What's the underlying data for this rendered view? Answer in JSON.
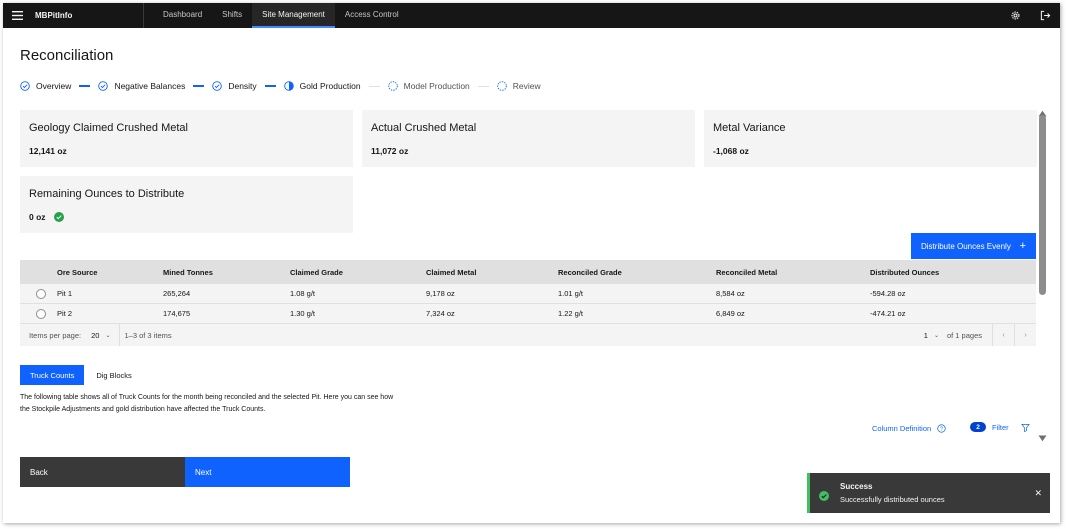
{
  "app": {
    "brand": "MBPitInfo"
  },
  "nav": {
    "items": [
      {
        "label": "Dashboard"
      },
      {
        "label": "Shifts"
      },
      {
        "label": "Site Management"
      },
      {
        "label": "Access Control"
      }
    ],
    "active": "Site Management"
  },
  "page": {
    "title": "Reconciliation"
  },
  "progress": {
    "steps": [
      {
        "label": "Overview",
        "state": "complete"
      },
      {
        "label": "Negative Balances",
        "state": "complete"
      },
      {
        "label": "Density",
        "state": "complete"
      },
      {
        "label": "Gold Production",
        "state": "current"
      },
      {
        "label": "Model Production",
        "state": "incomplete"
      },
      {
        "label": "Review",
        "state": "incomplete"
      }
    ]
  },
  "tiles": {
    "geology": {
      "title": "Geology Claimed Crushed Metal",
      "value": "12,141 oz"
    },
    "actual": {
      "title": "Actual Crushed Metal",
      "value": "11,072 oz"
    },
    "variance": {
      "title": "Metal Variance",
      "value": "-1,068 oz"
    },
    "remaining": {
      "title": "Remaining Ounces to Distribute",
      "value": "0 oz",
      "status_icon": "checkmark-filled-icon"
    }
  },
  "distribute_button": {
    "label": "Distribute Ounces Evenly",
    "icon": "add-icon"
  },
  "table": {
    "headers": [
      "Ore Source",
      "Mined Tonnes",
      "Claimed Grade",
      "Claimed Metal",
      "Reconciled Grade",
      "Reconciled Metal",
      "Distributed Ounces"
    ],
    "rows": [
      [
        "Pit 1",
        "265,264",
        "1.08 g/t",
        "9,178 oz",
        "1.01 g/t",
        "8,584 oz",
        "-594.28 oz"
      ],
      [
        "Pit 2",
        "174,675",
        "1.30 g/t",
        "7,324 oz",
        "1.22 g/t",
        "6,849 oz",
        "-474.21 oz"
      ]
    ],
    "pagination": {
      "items_per_page_label": "Items per page:",
      "items_per_page": "20",
      "range": "1–3 of 3 items",
      "page": "1",
      "of_pages": "of 1 pages"
    }
  },
  "tabs": [
    {
      "label": "Truck Counts",
      "active": true
    },
    {
      "label": "Dig Blocks",
      "active": false
    }
  ],
  "description": "The following table shows all of Truck Counts for the month being reconciled and the selected Pit. Here you can see how the Stockpile Adjustments and gold distribution have affected the Truck Counts.",
  "column_definition": {
    "label": "Column Definition"
  },
  "filter": {
    "count": "2",
    "label": "Filter"
  },
  "buttons": {
    "back": "Back",
    "next": "Next"
  },
  "toast": {
    "title": "Success",
    "subtitle": "Successfully distributed ounces",
    "kind": "success"
  },
  "colors": {
    "primary": "#0f62fe",
    "success": "#42be65",
    "topbar": "#161616",
    "tile_bg": "#f4f4f4"
  }
}
